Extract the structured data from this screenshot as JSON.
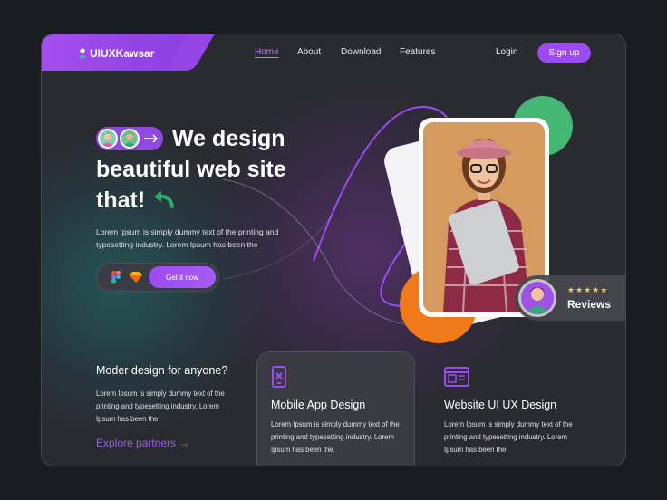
{
  "brand": {
    "name": "UIUXKawsar"
  },
  "nav": {
    "home": "Home",
    "about": "About",
    "download": "Download",
    "features": "Features",
    "login": "Login",
    "signup": "Sign up"
  },
  "hero": {
    "line1": "We design",
    "line2": "beautiful web site",
    "line3": "that!",
    "text_line1": "Lorem Ipsum is simply dummy text of the printing and",
    "text_line2": "typesetting industry. Lorem Ipsum has been the",
    "cta": "Get it now",
    "tool_icons": [
      "figma-icon",
      "sketch-icon"
    ]
  },
  "reviews": {
    "stars": "★★★★★",
    "label": "Reviews",
    "rating": 5
  },
  "section_left": {
    "title": "Moder design for anyone?",
    "text_line1": "Lorem Ipsum is simply dummy text of the",
    "text_line2": "printing and typesetting industry. Lorem",
    "text_line3": "Ipsum has been the.",
    "link": "Explore partners →"
  },
  "service_mobile": {
    "title": "Mobile App Design",
    "icon": "mobile-icon",
    "text_line1": "Lorem Ipsum is simply dummy text of the",
    "text_line2": "printing and typesetting industry. Lorem",
    "text_line3": "Ipsum has been the."
  },
  "service_web": {
    "title": "Website UI UX Design",
    "icon": "website-icon",
    "text_line1": "Lorem Ipsum is simply dummy text of the",
    "text_line2": "printing and typesetting industry. Lorem",
    "text_line3": "Ipsum has been the."
  },
  "colors": {
    "accent": "#9b4bf0",
    "background": "#2a2b31",
    "green": "#44b774",
    "orange": "#f07a1a",
    "star": "#f7c948"
  }
}
